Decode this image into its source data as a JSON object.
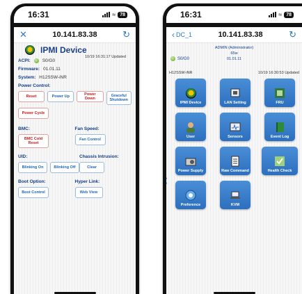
{
  "left": {
    "status": {
      "time": "16:31",
      "battery": "78"
    },
    "nav": {
      "title": "10.141.83.38"
    },
    "device": {
      "title": "IPMI Device",
      "updated": "10/19 16:31:17 Updated",
      "acpi_label": "ACPI:",
      "acpi_value": "S0/G0",
      "firmware_label": "Firmware:",
      "firmware_value": "01.01.11",
      "system_label": "System:",
      "system_value": "H12SSW-iNR"
    },
    "power": {
      "label": "Power Control:",
      "reset": "Reset",
      "power_up": "Power Up",
      "power_down": "Power Down",
      "graceful": "Graceful Shutdown",
      "power_cycle": "Power Cycle"
    },
    "bmc": {
      "label": "BMC:",
      "cold_reset": "BMC Cold Reset"
    },
    "fan": {
      "label": "Fan Speed:",
      "control": "Fan Control"
    },
    "uid": {
      "label": "UID:",
      "blink_on": "Blinking On",
      "blink_off": "Blinking Off"
    },
    "chassis": {
      "label": "Chassis Intrusion:",
      "clear": "Clear"
    },
    "boot": {
      "label": "Boot Option:",
      "control": "Boot Control"
    },
    "hyper": {
      "label": "Hyper Link:",
      "web_view": "Web View"
    }
  },
  "right": {
    "status": {
      "time": "16:31",
      "battery": "78"
    },
    "nav": {
      "back": "DC_1",
      "title": "10.141.83.38"
    },
    "user": {
      "line1": "ADMIN (Administrator)",
      "line2": "65w",
      "line3": "01.01.11"
    },
    "acpi_value": "S0/G0",
    "system": "H12SSW-iNR",
    "updated": "10/19 16:30:53 Updated",
    "tiles": [
      {
        "label": "IPMI Device",
        "icon": "ipmi-logo-icon"
      },
      {
        "label": "LAN Setting",
        "icon": "network-icon"
      },
      {
        "label": "FRU",
        "icon": "chip-icon"
      },
      {
        "label": "User",
        "icon": "user-icon"
      },
      {
        "label": "Sensors",
        "icon": "monitor-icon"
      },
      {
        "label": "Event Log",
        "icon": "book-icon"
      },
      {
        "label": "Power Supply",
        "icon": "power-supply-icon"
      },
      {
        "label": "Raw Command",
        "icon": "document-icon"
      },
      {
        "label": "Health Check",
        "icon": "health-icon"
      },
      {
        "label": "Preference",
        "icon": "gear-icon"
      },
      {
        "label": "KVM",
        "icon": "laptop-icon"
      }
    ]
  }
}
